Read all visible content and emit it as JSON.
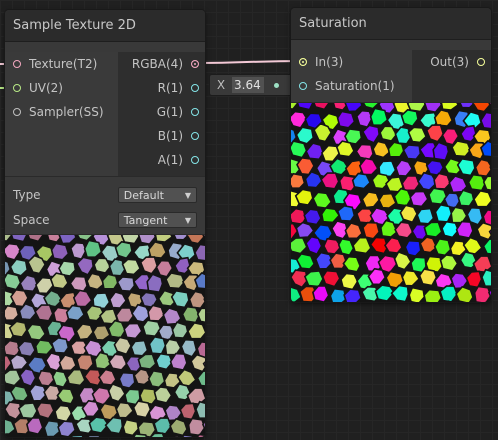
{
  "colors": {
    "background": "#202020",
    "node_body": "#393939",
    "node_header": "#2b2b2b",
    "wire_rgba": "#f3c9d6",
    "wire_float": "#9de0c4",
    "port_texture": "#f4a8c0",
    "port_uv": "#b8e986",
    "port_float": "#84e4e7",
    "port_vector3": "#f6ff9a"
  },
  "node_sample_texture": {
    "title": "Sample Texture 2D",
    "inputs": [
      {
        "label": "Texture(T2)",
        "icon": "texture-port-icon"
      },
      {
        "label": "UV(2)",
        "icon": "uv-port-icon"
      },
      {
        "label": "Sampler(SS)",
        "icon": "sampler-port-icon"
      }
    ],
    "outputs": [
      {
        "label": "RGBA(4)"
      },
      {
        "label": "R(1)"
      },
      {
        "label": "G(1)"
      },
      {
        "label": "B(1)"
      },
      {
        "label": "A(1)"
      }
    ],
    "settings": {
      "type_label": "Type",
      "type_value": "Default",
      "space_label": "Space",
      "space_value": "Tangent"
    },
    "preview_style": "pastel voronoi normal-map texture"
  },
  "node_saturation": {
    "title": "Saturation",
    "inputs": [
      {
        "label": "In(3)"
      },
      {
        "label": "Saturation(1)"
      }
    ],
    "outputs": [
      {
        "label": "Out(3)"
      }
    ],
    "preview_style": "highly saturated voronoi texture"
  },
  "saturation_field": {
    "axis_label": "X",
    "value": "3.64"
  }
}
